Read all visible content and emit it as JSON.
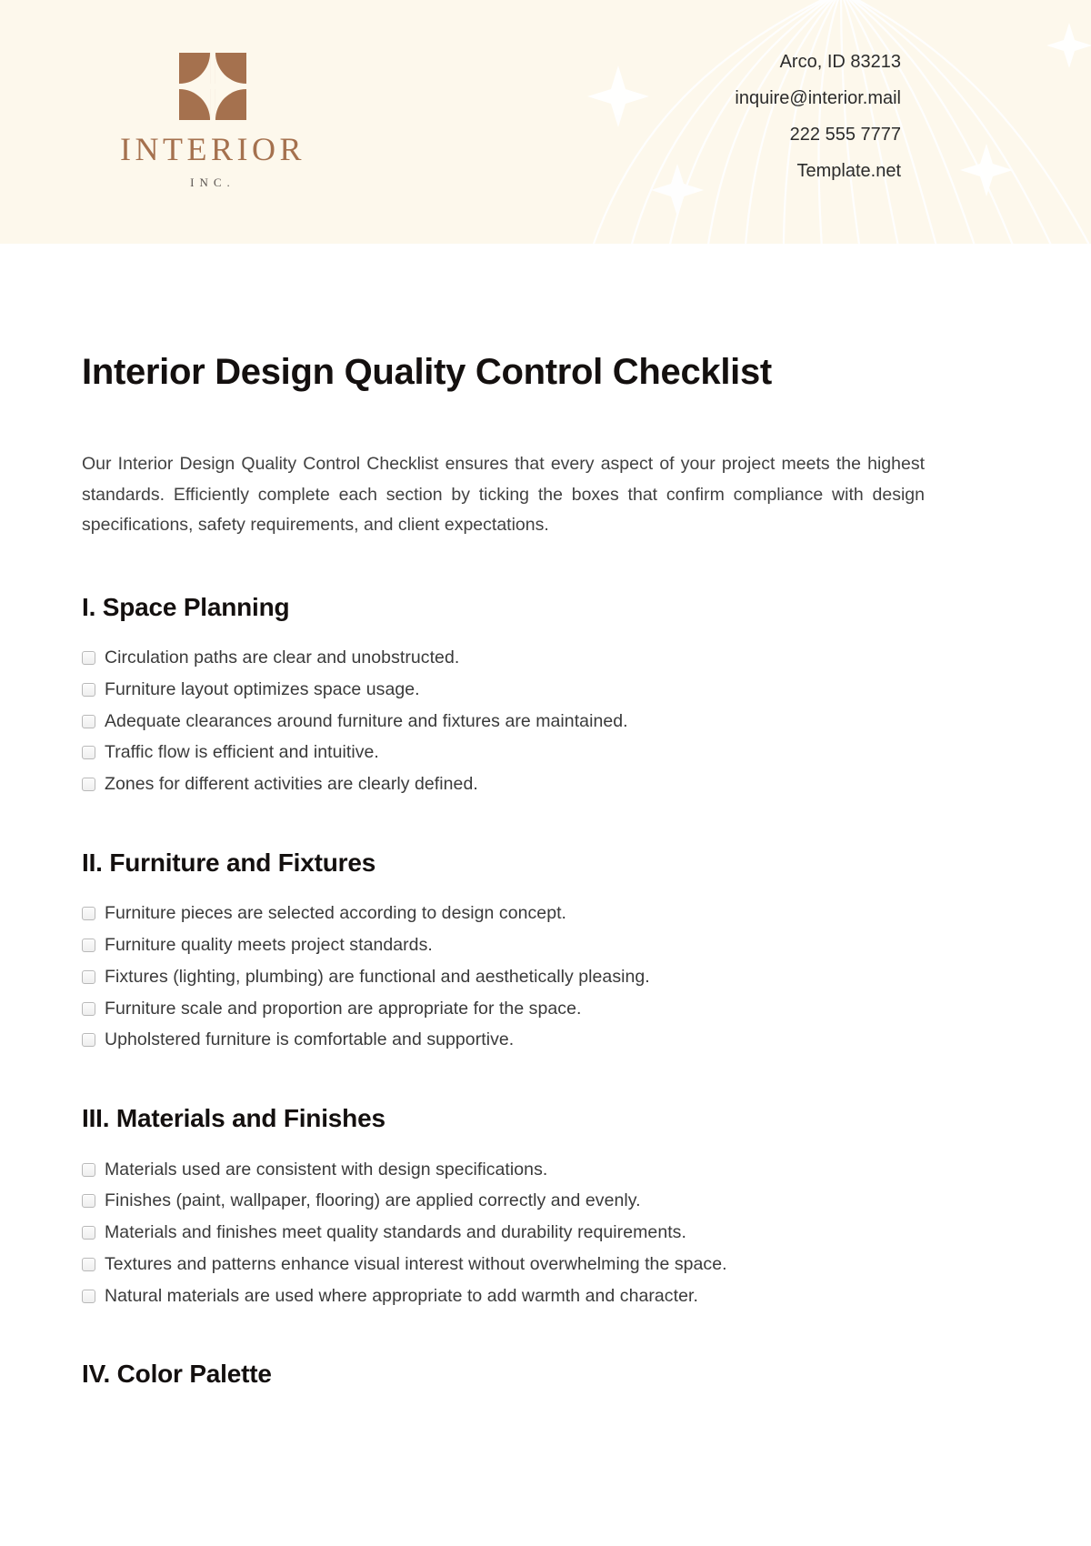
{
  "brand": {
    "logo_icon": "interior-quatrefoil-logo-icon",
    "name": "INTERIOR",
    "suffix": "INC.",
    "accent_color": "#a5714e",
    "header_bg": "#fdf8ec"
  },
  "header": {
    "contact": [
      "Arco, ID 83213",
      "inquire@interior.mail",
      "222 555 7777",
      "Template.net"
    ],
    "decoration": "globe-wireframe-sparkles"
  },
  "document": {
    "title": "Interior Design Quality Control Checklist",
    "intro": "Our Interior Design Quality Control Checklist ensures that every aspect of your project meets the highest standards. Efficiently complete each section by ticking the boxes that confirm compliance with design specifications, safety requirements, and client expectations."
  },
  "sections": [
    {
      "title": "I. Space Planning",
      "items": [
        "Circulation paths are clear and unobstructed.",
        "Furniture layout optimizes space usage.",
        "Adequate clearances around furniture and fixtures are maintained.",
        "Traffic flow is efficient and intuitive.",
        "Zones for different activities are clearly defined."
      ]
    },
    {
      "title": "II. Furniture and Fixtures",
      "items": [
        "Furniture pieces are selected according to design concept.",
        "Furniture quality meets project standards.",
        "Fixtures (lighting, plumbing) are functional and aesthetically pleasing.",
        "Furniture scale and proportion are appropriate for the space.",
        "Upholstered furniture is comfortable and supportive."
      ]
    },
    {
      "title": "III. Materials and Finishes",
      "items": [
        "Materials used are consistent with design specifications.",
        "Finishes (paint, wallpaper, flooring) are applied correctly and evenly.",
        "Materials and finishes meet quality standards and durability requirements.",
        "Textures and patterns enhance visual interest without overwhelming the space.",
        "Natural materials are used where appropriate to add warmth and character."
      ]
    },
    {
      "title": "IV. Color Palette",
      "items": []
    }
  ]
}
